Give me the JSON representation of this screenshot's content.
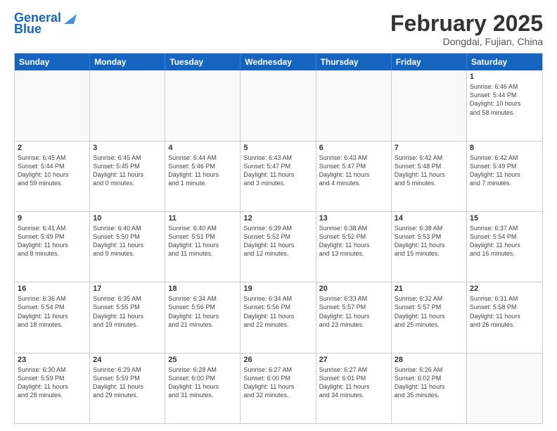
{
  "header": {
    "logo_line1": "General",
    "logo_line2": "Blue",
    "month_title": "February 2025",
    "location": "Dongdai, Fujian, China"
  },
  "days_of_week": [
    "Sunday",
    "Monday",
    "Tuesday",
    "Wednesday",
    "Thursday",
    "Friday",
    "Saturday"
  ],
  "weeks": [
    [
      {
        "day": "",
        "empty": true,
        "lines": []
      },
      {
        "day": "",
        "empty": true,
        "lines": []
      },
      {
        "day": "",
        "empty": true,
        "lines": []
      },
      {
        "day": "",
        "empty": true,
        "lines": []
      },
      {
        "day": "",
        "empty": true,
        "lines": []
      },
      {
        "day": "",
        "empty": true,
        "lines": []
      },
      {
        "day": "1",
        "empty": false,
        "lines": [
          "Sunrise: 6:46 AM",
          "Sunset: 5:44 PM",
          "Daylight: 10 hours",
          "and 58 minutes."
        ]
      }
    ],
    [
      {
        "day": "2",
        "empty": false,
        "lines": [
          "Sunrise: 6:45 AM",
          "Sunset: 5:44 PM",
          "Daylight: 10 hours",
          "and 59 minutes."
        ]
      },
      {
        "day": "3",
        "empty": false,
        "lines": [
          "Sunrise: 6:45 AM",
          "Sunset: 5:45 PM",
          "Daylight: 11 hours",
          "and 0 minutes."
        ]
      },
      {
        "day": "4",
        "empty": false,
        "lines": [
          "Sunrise: 6:44 AM",
          "Sunset: 5:46 PM",
          "Daylight: 11 hours",
          "and 1 minute."
        ]
      },
      {
        "day": "5",
        "empty": false,
        "lines": [
          "Sunrise: 6:43 AM",
          "Sunset: 5:47 PM",
          "Daylight: 11 hours",
          "and 3 minutes."
        ]
      },
      {
        "day": "6",
        "empty": false,
        "lines": [
          "Sunrise: 6:43 AM",
          "Sunset: 5:47 PM",
          "Daylight: 11 hours",
          "and 4 minutes."
        ]
      },
      {
        "day": "7",
        "empty": false,
        "lines": [
          "Sunrise: 6:42 AM",
          "Sunset: 5:48 PM",
          "Daylight: 11 hours",
          "and 5 minutes."
        ]
      },
      {
        "day": "8",
        "empty": false,
        "lines": [
          "Sunrise: 6:42 AM",
          "Sunset: 5:49 PM",
          "Daylight: 11 hours",
          "and 7 minutes."
        ]
      }
    ],
    [
      {
        "day": "9",
        "empty": false,
        "lines": [
          "Sunrise: 6:41 AM",
          "Sunset: 5:49 PM",
          "Daylight: 11 hours",
          "and 8 minutes."
        ]
      },
      {
        "day": "10",
        "empty": false,
        "lines": [
          "Sunrise: 6:40 AM",
          "Sunset: 5:50 PM",
          "Daylight: 11 hours",
          "and 9 minutes."
        ]
      },
      {
        "day": "11",
        "empty": false,
        "lines": [
          "Sunrise: 6:40 AM",
          "Sunset: 5:51 PM",
          "Daylight: 11 hours",
          "and 11 minutes."
        ]
      },
      {
        "day": "12",
        "empty": false,
        "lines": [
          "Sunrise: 6:39 AM",
          "Sunset: 5:52 PM",
          "Daylight: 11 hours",
          "and 12 minutes."
        ]
      },
      {
        "day": "13",
        "empty": false,
        "lines": [
          "Sunrise: 6:38 AM",
          "Sunset: 5:52 PM",
          "Daylight: 11 hours",
          "and 13 minutes."
        ]
      },
      {
        "day": "14",
        "empty": false,
        "lines": [
          "Sunrise: 6:38 AM",
          "Sunset: 5:53 PM",
          "Daylight: 11 hours",
          "and 15 minutes."
        ]
      },
      {
        "day": "15",
        "empty": false,
        "lines": [
          "Sunrise: 6:37 AM",
          "Sunset: 5:54 PM",
          "Daylight: 11 hours",
          "and 16 minutes."
        ]
      }
    ],
    [
      {
        "day": "16",
        "empty": false,
        "lines": [
          "Sunrise: 6:36 AM",
          "Sunset: 5:54 PM",
          "Daylight: 11 hours",
          "and 18 minutes."
        ]
      },
      {
        "day": "17",
        "empty": false,
        "lines": [
          "Sunrise: 6:35 AM",
          "Sunset: 5:55 PM",
          "Daylight: 11 hours",
          "and 19 minutes."
        ]
      },
      {
        "day": "18",
        "empty": false,
        "lines": [
          "Sunrise: 6:34 AM",
          "Sunset: 5:56 PM",
          "Daylight: 11 hours",
          "and 21 minutes."
        ]
      },
      {
        "day": "19",
        "empty": false,
        "lines": [
          "Sunrise: 6:34 AM",
          "Sunset: 5:56 PM",
          "Daylight: 11 hours",
          "and 22 minutes."
        ]
      },
      {
        "day": "20",
        "empty": false,
        "lines": [
          "Sunrise: 6:33 AM",
          "Sunset: 5:57 PM",
          "Daylight: 11 hours",
          "and 23 minutes."
        ]
      },
      {
        "day": "21",
        "empty": false,
        "lines": [
          "Sunrise: 6:32 AM",
          "Sunset: 5:57 PM",
          "Daylight: 11 hours",
          "and 25 minutes."
        ]
      },
      {
        "day": "22",
        "empty": false,
        "lines": [
          "Sunrise: 6:31 AM",
          "Sunset: 5:58 PM",
          "Daylight: 11 hours",
          "and 26 minutes."
        ]
      }
    ],
    [
      {
        "day": "23",
        "empty": false,
        "lines": [
          "Sunrise: 6:30 AM",
          "Sunset: 5:59 PM",
          "Daylight: 11 hours",
          "and 28 minutes."
        ]
      },
      {
        "day": "24",
        "empty": false,
        "lines": [
          "Sunrise: 6:29 AM",
          "Sunset: 5:59 PM",
          "Daylight: 11 hours",
          "and 29 minutes."
        ]
      },
      {
        "day": "25",
        "empty": false,
        "lines": [
          "Sunrise: 6:28 AM",
          "Sunset: 6:00 PM",
          "Daylight: 11 hours",
          "and 31 minutes."
        ]
      },
      {
        "day": "26",
        "empty": false,
        "lines": [
          "Sunrise: 6:27 AM",
          "Sunset: 6:00 PM",
          "Daylight: 11 hours",
          "and 32 minutes."
        ]
      },
      {
        "day": "27",
        "empty": false,
        "lines": [
          "Sunrise: 6:27 AM",
          "Sunset: 6:01 PM",
          "Daylight: 11 hours",
          "and 34 minutes."
        ]
      },
      {
        "day": "28",
        "empty": false,
        "lines": [
          "Sunrise: 6:26 AM",
          "Sunset: 6:02 PM",
          "Daylight: 11 hours",
          "and 35 minutes."
        ]
      },
      {
        "day": "",
        "empty": true,
        "lines": []
      }
    ]
  ]
}
